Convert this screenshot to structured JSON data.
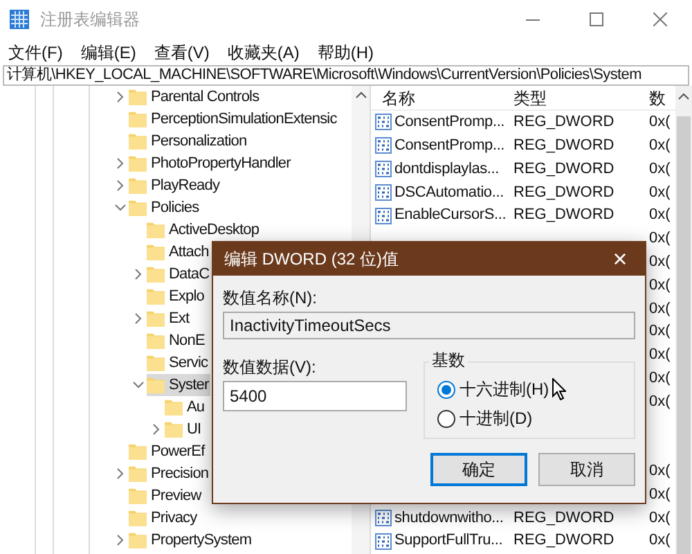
{
  "window": {
    "title": "注册表编辑器"
  },
  "menu": [
    "文件(F)",
    "编辑(E)",
    "查看(V)",
    "收藏夹(A)",
    "帮助(H)"
  ],
  "address": "计算机\\HKEY_LOCAL_MACHINE\\SOFTWARE\\Microsoft\\Windows\\CurrentVersion\\Policies\\System",
  "tree": [
    {
      "label": "Parental Controls",
      "expanded": false,
      "selected": false
    },
    {
      "label": "PerceptionSimulationExtensic",
      "selected": false
    },
    {
      "label": "Personalization",
      "selected": false
    },
    {
      "label": "PhotoPropertyHandler",
      "expanded": false,
      "selected": false
    },
    {
      "label": "PlayReady",
      "expanded": false,
      "selected": false
    },
    {
      "label": "Policies",
      "expanded": true,
      "selected": false,
      "children": [
        {
          "label": "ActiveDesktop",
          "selected": false
        },
        {
          "label": "Attach",
          "selected": false
        },
        {
          "label": "DataC",
          "expanded": false,
          "selected": false
        },
        {
          "label": "Explo",
          "selected": false
        },
        {
          "label": "Ext",
          "expanded": false,
          "selected": false
        },
        {
          "label": "NonE",
          "selected": false
        },
        {
          "label": "Servic",
          "selected": false
        },
        {
          "label": "Syster",
          "expanded": true,
          "selected": true,
          "children": [
            {
              "label": "Au",
              "selected": false
            },
            {
              "label": "UI",
              "expanded": false,
              "selected": false
            }
          ]
        }
      ]
    },
    {
      "label": "PowerEf",
      "selected": false
    },
    {
      "label": "Precision",
      "expanded": false,
      "selected": false
    },
    {
      "label": "Preview",
      "selected": false
    },
    {
      "label": "Privacy",
      "selected": false
    },
    {
      "label": "PropertySystem",
      "expanded": false,
      "selected": false
    }
  ],
  "list": {
    "columns": [
      "名称",
      "类型",
      "数"
    ],
    "rows": [
      {
        "name": "ConsentPromp...",
        "type": "REG_DWORD",
        "data": "0x("
      },
      {
        "name": "ConsentPromp...",
        "type": "REG_DWORD",
        "data": "0x("
      },
      {
        "name": "dontdisplaylas...",
        "type": "REG_DWORD",
        "data": "0x("
      },
      {
        "name": "DSCAutomatio...",
        "type": "REG_DWORD",
        "data": "0x("
      },
      {
        "name": "EnableCursorS...",
        "type": "REG_DWORD",
        "data": "0x("
      },
      {
        "data": "0x("
      },
      {
        "data": "0x("
      },
      {
        "data": "0x("
      },
      {
        "data": "0x("
      },
      {
        "data": "0x("
      },
      {
        "data": "0x("
      },
      {
        "data": "0x("
      },
      {
        "data": "0x("
      },
      {},
      {},
      {
        "data": "0x("
      },
      {
        "data": "0x("
      },
      {
        "name": "shutdownwitho...",
        "type": "REG_DWORD",
        "data": "0x("
      },
      {
        "name": "SupportFullTru...",
        "type": "REG_DWORD",
        "data": "0x("
      }
    ]
  },
  "dialog": {
    "title": "编辑 DWORD (32 位)值",
    "close": "×",
    "name_label": "数值名称(N):",
    "name_value": "InactivityTimeoutSecs",
    "data_label": "数值数据(V):",
    "data_value": "5400",
    "base_label": "基数",
    "base_options": [
      {
        "label": "十六进制(H)",
        "selected": true
      },
      {
        "label": "十进制(D)",
        "selected": false
      }
    ],
    "buttons": [
      {
        "label": "确定",
        "focused": true
      },
      {
        "label": "取消",
        "focused": false
      }
    ]
  }
}
